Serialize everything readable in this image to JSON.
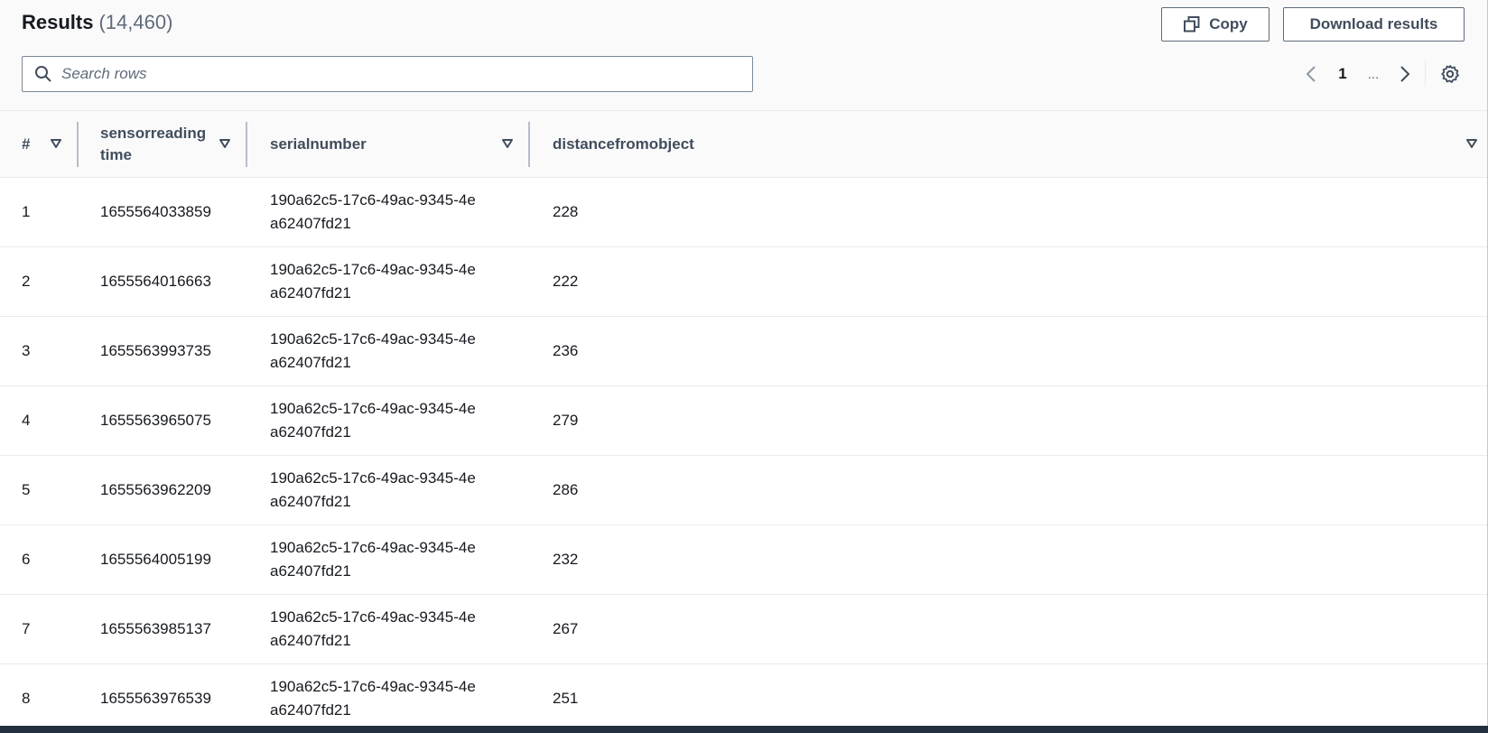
{
  "header": {
    "title": "Results",
    "count": "(14,460)",
    "copy_label": "Copy",
    "download_label": "Download results"
  },
  "search": {
    "placeholder": "Search rows"
  },
  "pagination": {
    "current_page": "1",
    "ellipsis": "..."
  },
  "table": {
    "columns": [
      "#",
      "sensorreading time",
      "serialnumber",
      "distancefromobject"
    ],
    "rows": [
      {
        "num": "1",
        "sensorreadingtime": "1655564033859",
        "serialnumber": "190a62c5-17c6-49ac-9345-4ea62407fd21",
        "distancefromobject": "228"
      },
      {
        "num": "2",
        "sensorreadingtime": "1655564016663",
        "serialnumber": "190a62c5-17c6-49ac-9345-4ea62407fd21",
        "distancefromobject": "222"
      },
      {
        "num": "3",
        "sensorreadingtime": "1655563993735",
        "serialnumber": "190a62c5-17c6-49ac-9345-4ea62407fd21",
        "distancefromobject": "236"
      },
      {
        "num": "4",
        "sensorreadingtime": "1655563965075",
        "serialnumber": "190a62c5-17c6-49ac-9345-4ea62407fd21",
        "distancefromobject": "279"
      },
      {
        "num": "5",
        "sensorreadingtime": "1655563962209",
        "serialnumber": "190a62c5-17c6-49ac-9345-4ea62407fd21",
        "distancefromobject": "286"
      },
      {
        "num": "6",
        "sensorreadingtime": "1655564005199",
        "serialnumber": "190a62c5-17c6-49ac-9345-4ea62407fd21",
        "distancefromobject": "232"
      },
      {
        "num": "7",
        "sensorreadingtime": "1655563985137",
        "serialnumber": "190a62c5-17c6-49ac-9345-4ea62407fd21",
        "distancefromobject": "267"
      },
      {
        "num": "8",
        "sensorreadingtime": "1655563976539",
        "serialnumber": "190a62c5-17c6-49ac-9345-4ea62407fd21",
        "distancefromobject": "251"
      }
    ]
  },
  "icons": {
    "copy": "copy-icon",
    "search": "search-icon",
    "prev": "chevron-left-icon",
    "next": "chevron-right-icon",
    "settings": "gear-icon",
    "sort": "sort-caret-down-icon"
  },
  "colors": {
    "heading_text": "#16191f",
    "secondary_text": "#5f6b7a",
    "border": "#e9ebed",
    "footer_bar": "#232f3e"
  }
}
